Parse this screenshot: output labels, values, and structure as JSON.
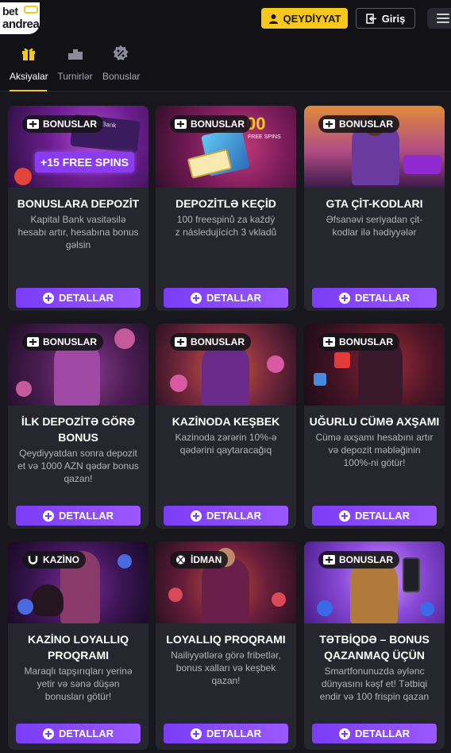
{
  "header": {
    "logo_line1": "bet",
    "logo_line2": "andreas",
    "register_label": "QEYDİYYAT",
    "login_label": "Giriş"
  },
  "tabs": [
    {
      "label": "Aksiyalar",
      "icon": "gift-icon",
      "active": true
    },
    {
      "label": "Turnirlər",
      "icon": "podium-icon",
      "active": false
    },
    {
      "label": "Bonuslar",
      "icon": "percent-icon",
      "active": false
    }
  ],
  "colors": {
    "accent_yellow": "#f6c81e",
    "button_purple": "#7a3cf5",
    "card_bg": "#26262e",
    "page_bg": "#17171d"
  },
  "promos": [
    {
      "badge": "BONUSLAR",
      "badge_icon": "ticket-icon",
      "title": "BONUSLARA DEPOZİT",
      "desc_lines": [
        "Kapital Bank vasitəsilə",
        "hesabı artır, hesabına bonus",
        "gəlsin"
      ],
      "button": "DETALLAR",
      "image_text": "+15 FREE SPINS",
      "image_text2": "pital Bank"
    },
    {
      "badge": "BONUSLAR",
      "badge_icon": "ticket-icon",
      "title": "DEPOZİTLƏ KEÇİD",
      "desc_lines": [
        "100 freespinů za každý",
        "z následujících 3 vkladů"
      ],
      "button": "DETALLAR",
      "image_text": "00",
      "image_text2": "FREE SPINS"
    },
    {
      "badge": "BONUSLAR",
      "badge_icon": "ticket-icon",
      "title": "GTA ÇİT-KODLARI",
      "desc_lines": [
        "Əfsanəvi seriyadan çit-",
        "kodlar ilə hədiyyələr"
      ],
      "button": "DETALLAR"
    },
    {
      "badge": "BONUSLAR",
      "badge_icon": "ticket-icon",
      "title": "İLK DEPOZİTƏ GÖRƏ BONUS",
      "desc_lines": [
        "Qeydiyyatdan sonra depozit",
        "et və 1000 AZN qədər bonus",
        "qazan!"
      ],
      "button": "DETALLAR"
    },
    {
      "badge": "BONUSLAR",
      "badge_icon": "ticket-icon",
      "title": "KAZİNODA KEŞBEK",
      "desc_lines": [
        "Kazinoda zərərin 10%-ə",
        "qədərini qaytaracağıq"
      ],
      "button": "DETALLAR"
    },
    {
      "badge": "BONUSLAR",
      "badge_icon": "ticket-icon",
      "title": "UĞURLU CÜMƏ AXŞAMI",
      "desc_lines": [
        "Cümə axşamı hesabını artır",
        "və depozit məbləğinin",
        "100%-ni götür!"
      ],
      "button": "DETALLAR"
    },
    {
      "badge": "KAZİNO",
      "badge_icon": "horseshoe-icon",
      "title": "KAZİNO LOYALLIQ PROQRAMI",
      "desc_lines": [
        "Maraqlı tapşırıqları yerinə",
        "yetir və sənə düşən",
        "bonusları götür!"
      ],
      "button": "DETALLAR"
    },
    {
      "badge": "İDMAN",
      "badge_icon": "ball-icon",
      "title": "LOYALLIQ PROQRAMI",
      "desc_lines": [
        "Nailiyyətlərə görə fribetlər,",
        "bonus xalları və keşbek",
        "qazan!"
      ],
      "button": "DETALLAR"
    },
    {
      "badge": "BONUSLAR",
      "badge_icon": "ticket-icon",
      "title": "TƏTBİQDƏ – BONUS QAZANMAQ ÜÇÜN",
      "desc_lines": [
        "Smartfonunuzda əylənc",
        "dünyasını kəşf et! Tətbiqi",
        "endir və 100 frispin qazan"
      ],
      "button": "DETALLAR"
    }
  ]
}
